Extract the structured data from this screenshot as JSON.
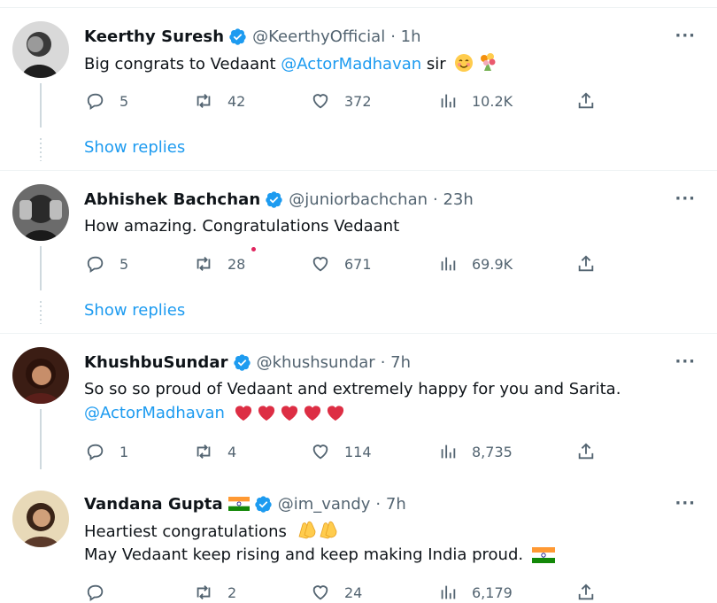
{
  "tweets": [
    {
      "name": "Keerthy Suresh",
      "handle": "@KeerthyOfficial",
      "time": "· 1h",
      "text_before": "Big congrats to Vedaant ",
      "mention": "@ActorMadhavan",
      "text_after": " sir",
      "emoji": [
        "smiling-face-emoji",
        "bouquet-emoji"
      ],
      "replies": "5",
      "retweets": "42",
      "likes": "372",
      "views": "10.2K",
      "show_replies": "Show replies"
    },
    {
      "name": "Abhishek Bachchan",
      "handle": "@juniorbachchan",
      "time": "· 23h",
      "text": "How amazing. Congratulations Vedaant",
      "replies": "5",
      "retweets": "28",
      "likes": "671",
      "views": "69.9K",
      "show_replies": "Show replies"
    },
    {
      "name": "KhushbuSundar",
      "handle": "@khushsundar",
      "time": "· 7h",
      "text_line1": "So so so proud of Vedaant and extremely happy for you and Sarita.",
      "mention": "@ActorMadhavan",
      "hearts": 5,
      "replies": "1",
      "retweets": "4",
      "likes": "114",
      "views": "8,735"
    },
    {
      "name": "Vandana Gupta",
      "handle": "@im_vandy",
      "time": "· 7h",
      "text_line1": "Heartiest congratulations",
      "text_line2": "May Vedaant keep rising and keep making India proud.",
      "replies": "",
      "retweets": "2",
      "likes": "24",
      "views": "6,179"
    }
  ],
  "more_label": "···",
  "colors": {
    "accent": "#1d9bf0",
    "muted": "#536471",
    "heart": "#e0245e"
  }
}
